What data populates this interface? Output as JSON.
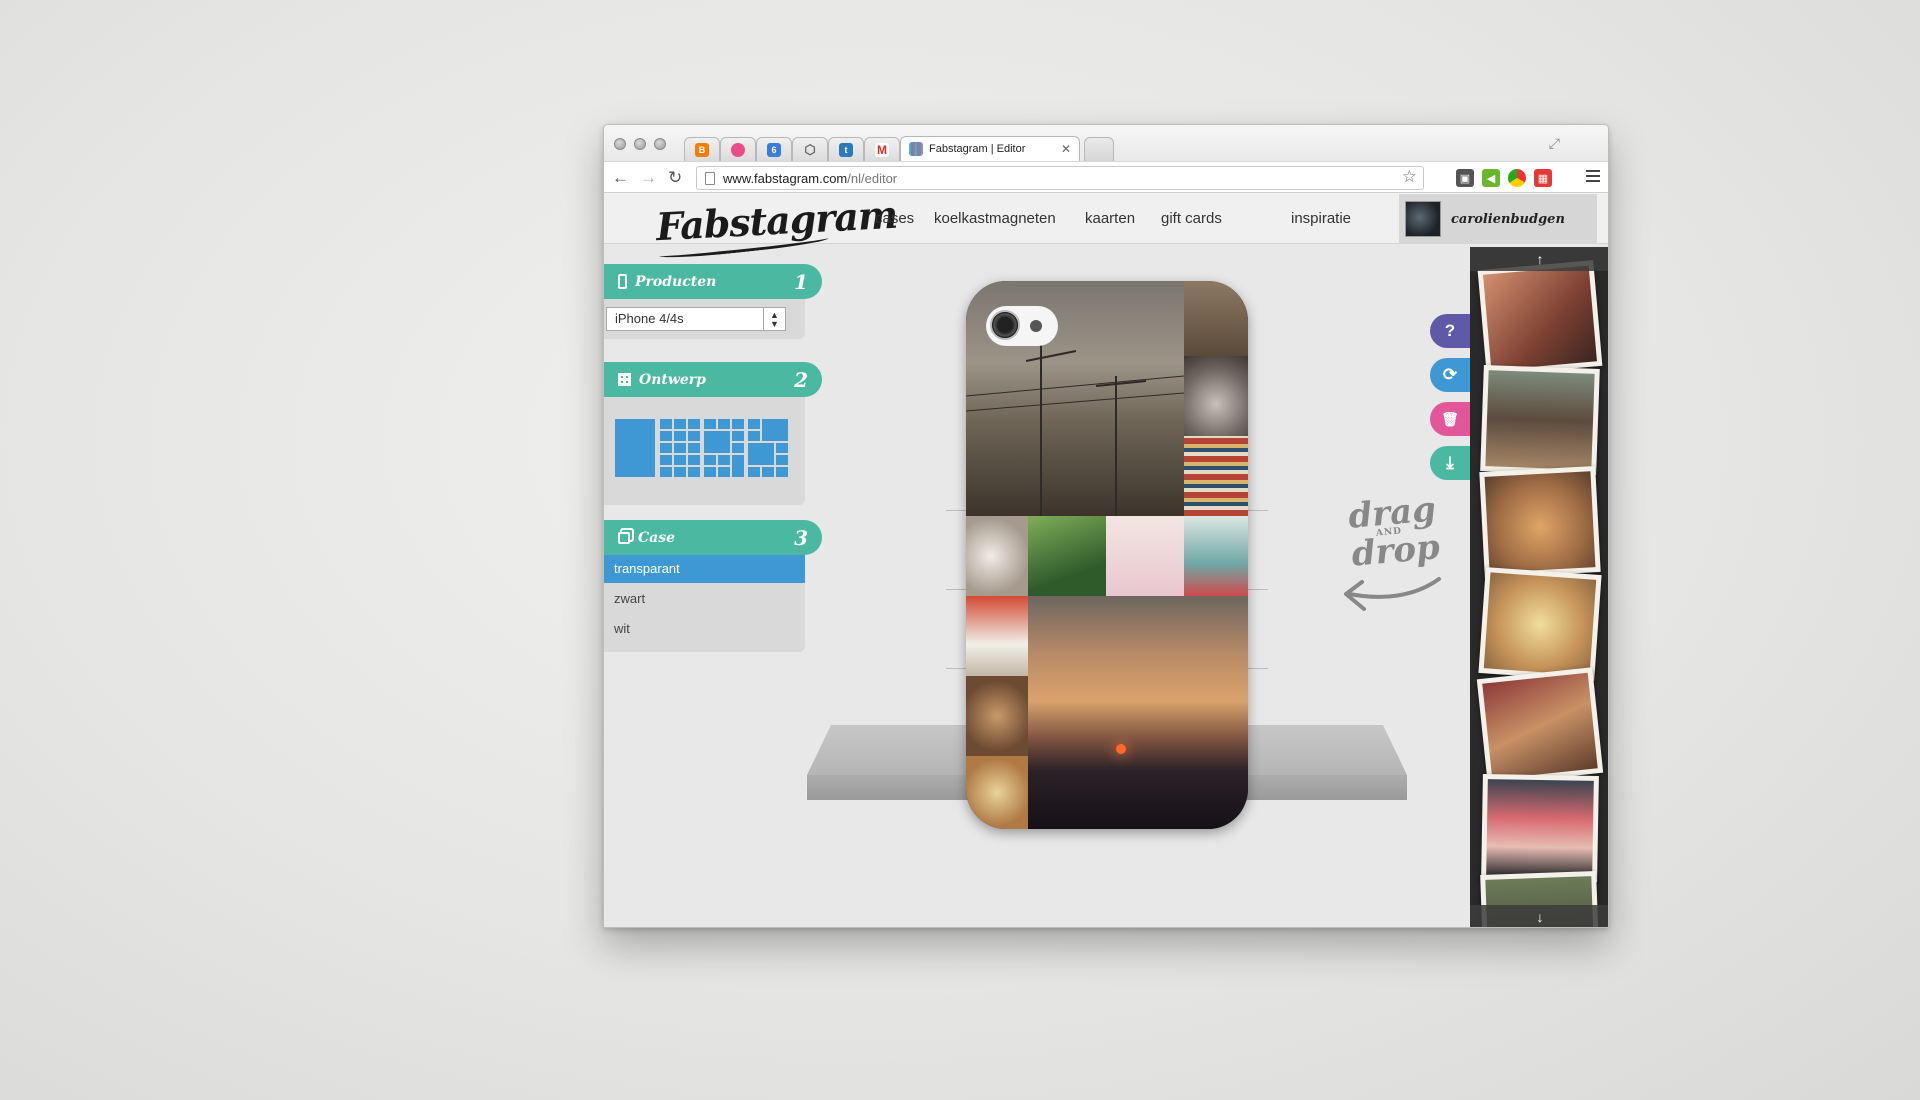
{
  "browser": {
    "active_tab_title": "Fabstagram | Editor",
    "url_host": "www.fabstagram.com",
    "url_path": "/nl/editor",
    "tabs": [
      {
        "icon": "blogger-icon",
        "color": "#f57d00"
      },
      {
        "icon": "dribbble-icon",
        "color": "#ea4c89"
      },
      {
        "icon": "calendar-icon",
        "color": "#3b7ddd",
        "text": "6"
      },
      {
        "icon": "codepen-icon",
        "color": "#777777"
      },
      {
        "icon": "twitter-icon",
        "color": "#2b7bb9"
      },
      {
        "icon": "gmail-icon",
        "color": "#d93025"
      }
    ]
  },
  "site": {
    "logo": "Fabstagram",
    "nav": [
      "cases",
      "koelkastmagneten",
      "kaarten",
      "gift cards",
      "inspiratie"
    ],
    "username": "carolienbudgen"
  },
  "steps": {
    "products": {
      "label": "Producten",
      "num": "1",
      "selected_model": "iPhone 4/4s"
    },
    "design": {
      "label": "Ontwerp",
      "num": "2"
    },
    "case": {
      "label": "Case",
      "num": "3",
      "options": [
        "transparant",
        "zwart",
        "wit"
      ],
      "selected": "transparant"
    }
  },
  "hint": {
    "line1": "drag",
    "and": "AND",
    "line2": "drop"
  },
  "actions": [
    {
      "name": "help-button",
      "icon": "?",
      "color": "#5f5aa8"
    },
    {
      "name": "refresh-button",
      "icon": "⟳",
      "color": "#3d98d3"
    },
    {
      "name": "trash-button",
      "icon": "🗑",
      "color": "#e2579a"
    },
    {
      "name": "save-button",
      "icon": "⤓",
      "color": "#4bb8a2"
    }
  ],
  "colors": {
    "teal": "#4bb8a2",
    "blue": "#3d98d3"
  }
}
